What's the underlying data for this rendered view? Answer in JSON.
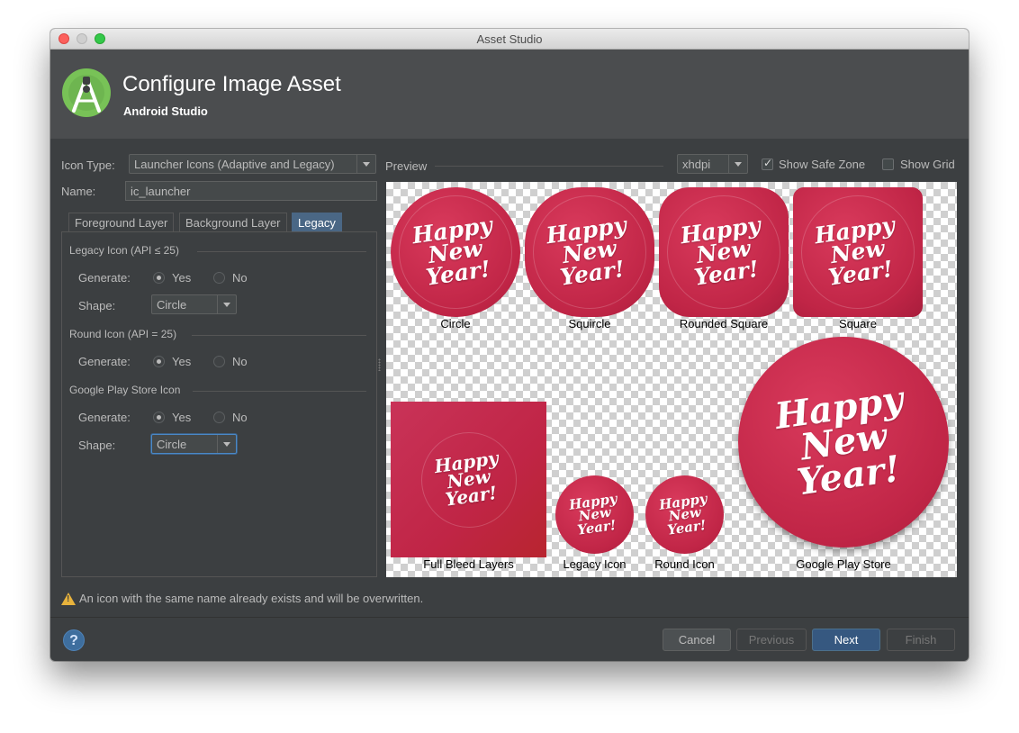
{
  "window": {
    "title": "Asset Studio"
  },
  "header": {
    "title": "Configure Image Asset",
    "subtitle": "Android Studio"
  },
  "form": {
    "icon_type_label": "Icon Type:",
    "icon_type_value": "Launcher Icons (Adaptive and Legacy)",
    "name_label": "Name:",
    "name_value": "ic_launcher"
  },
  "tabs": [
    {
      "label": "Foreground Layer",
      "selected": false
    },
    {
      "label": "Background Layer",
      "selected": false
    },
    {
      "label": "Legacy",
      "selected": true
    }
  ],
  "legacy_panel": {
    "legacy_icon": {
      "title": "Legacy Icon (API ≤ 25)",
      "generate_label": "Generate:",
      "yes": "Yes",
      "no": "No",
      "selected": "Yes",
      "shape_label": "Shape:",
      "shape_value": "Circle"
    },
    "round_icon": {
      "title": "Round Icon (API = 25)",
      "generate_label": "Generate:",
      "yes": "Yes",
      "no": "No",
      "selected": "Yes"
    },
    "play_store_icon": {
      "title": "Google Play Store Icon",
      "generate_label": "Generate:",
      "yes": "Yes",
      "no": "No",
      "selected": "Yes",
      "shape_label": "Shape:",
      "shape_value": "Circle"
    }
  },
  "preview": {
    "label": "Preview",
    "density": "xhdpi",
    "show_safe_zone": {
      "label": "Show Safe Zone",
      "checked": true
    },
    "show_grid": {
      "label": "Show Grid",
      "checked": false
    },
    "icon_text": [
      "Happy",
      "New",
      "Year!"
    ],
    "icons": [
      {
        "caption": "Circle"
      },
      {
        "caption": "Squircle"
      },
      {
        "caption": "Rounded Square"
      },
      {
        "caption": "Square"
      },
      {
        "caption": "Full Bleed Layers"
      },
      {
        "caption": "Legacy Icon"
      },
      {
        "caption": "Round Icon"
      },
      {
        "caption": "Google Play Store"
      }
    ]
  },
  "warning": "An icon with the same name already exists and will be overwritten.",
  "buttons": {
    "help": "?",
    "cancel": "Cancel",
    "previous": "Previous",
    "next": "Next",
    "finish": "Finish"
  },
  "colors": {
    "accent": "#4a6785",
    "icon_red": "#c02546",
    "warning": "#e8b33c",
    "primary_button": "#365880"
  }
}
